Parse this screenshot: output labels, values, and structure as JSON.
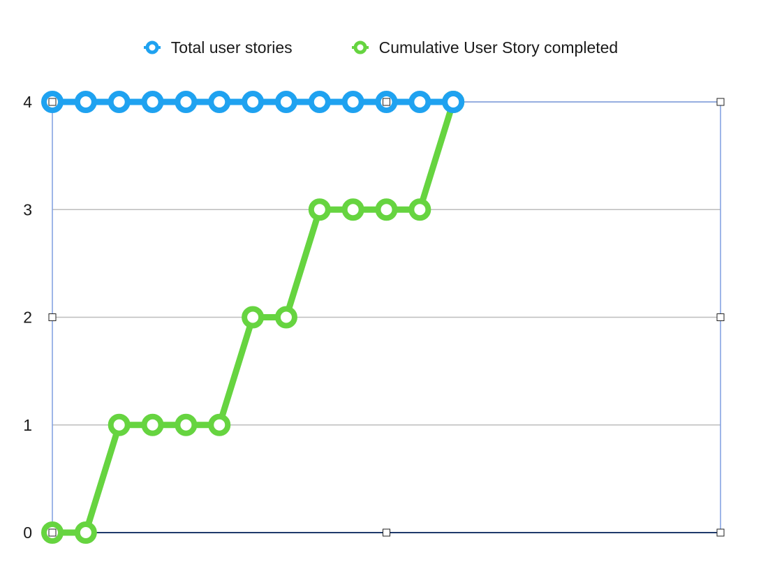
{
  "colors": {
    "total": "#1fa2f0",
    "completed": "#66d440",
    "grid": "#bdbdbd",
    "frame": "#7f9ee0",
    "baseline": "#1f3a6b",
    "handle_fill": "#ffffff",
    "handle_stroke": "#222222"
  },
  "chart_data": {
    "type": "line",
    "title": "",
    "xlabel": "",
    "ylabel": "",
    "x": [
      0,
      1,
      2,
      3,
      4,
      5,
      6,
      7,
      8,
      9,
      10,
      11,
      12
    ],
    "ylim": [
      0,
      4
    ],
    "xlim": [
      0,
      20
    ],
    "yticks": [
      "0",
      "1",
      "2",
      "3",
      "4"
    ],
    "grid": true,
    "legend_position": "top-center",
    "series": [
      {
        "name": "Total user stories",
        "color_key": "total",
        "values": [
          4,
          4,
          4,
          4,
          4,
          4,
          4,
          4,
          4,
          4,
          4,
          4,
          4
        ]
      },
      {
        "name": "Cumulative User Story completed",
        "color_key": "completed",
        "values": [
          0,
          0,
          1,
          1,
          1,
          1,
          2,
          2,
          3,
          3,
          3,
          3,
          4
        ]
      }
    ]
  }
}
